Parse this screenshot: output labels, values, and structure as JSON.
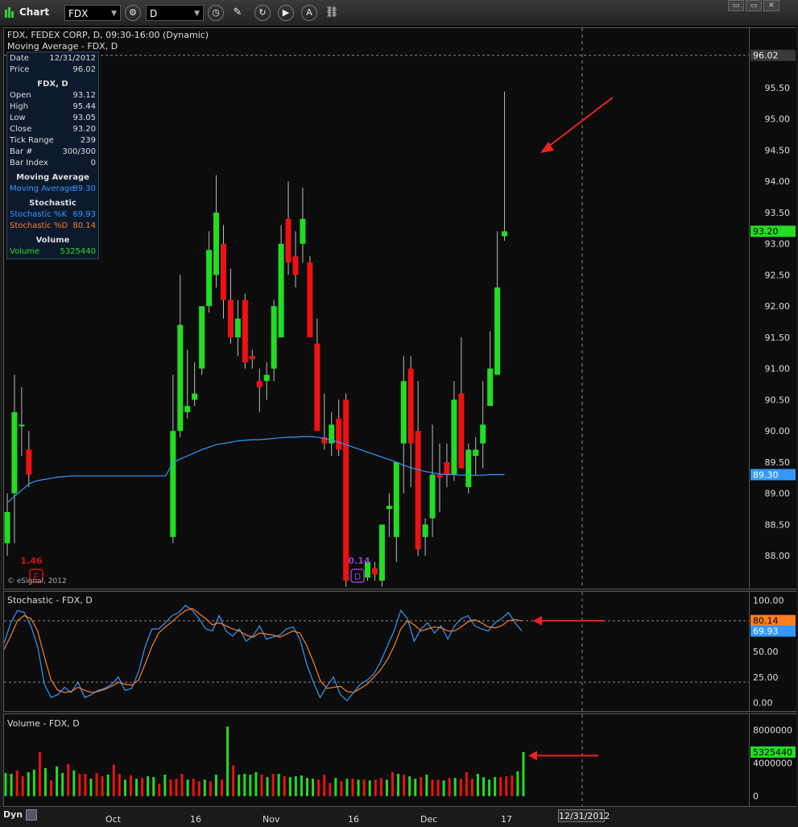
{
  "toolbar": {
    "title": "Chart",
    "symbol_value": "FDX",
    "interval_value": "D",
    "win_buttons": [
      "▭",
      "▭",
      "✕"
    ]
  },
  "price_panel": {
    "title": "FDX, FEDEX CORP, D, 09:30-16:00 (Dynamic)",
    "subtitle": "Moving Average - FDX, D",
    "copyright": "© eSignal, 2012",
    "last_price_label": "96.02",
    "close_label": "93.20",
    "ma_label": "89.30",
    "event_labels": [
      {
        "text": "1.46",
        "color": "#d01010",
        "marker": "E"
      },
      {
        "text": "0.14",
        "color": "#9040d0",
        "marker": "D"
      }
    ]
  },
  "data_window": {
    "rows1": [
      {
        "k": "Date",
        "v": "12/31/2012"
      },
      {
        "k": "Price",
        "v": "96.02"
      }
    ],
    "header_fdx": "FDX, D",
    "rows2": [
      {
        "k": "Open",
        "v": "93.12"
      },
      {
        "k": "High",
        "v": "95.44"
      },
      {
        "k": "Low",
        "v": "93.05"
      },
      {
        "k": "Close",
        "v": "93.20"
      },
      {
        "k": "Tick Range",
        "v": "239"
      },
      {
        "k": "Bar #",
        "v": "300/300"
      },
      {
        "k": "Bar Index",
        "v": "0"
      }
    ],
    "header_ma": "Moving Average",
    "ma_row": {
      "k": "Moving Average",
      "v": "89.30"
    },
    "header_stoch": "Stochastic",
    "stoch_k": {
      "k": "Stochastic %K",
      "v": "69.93"
    },
    "stoch_d": {
      "k": "Stochastic %D",
      "v": "80.14"
    },
    "header_vol": "Volume",
    "vol_row": {
      "k": "Volume",
      "v": "5325440"
    }
  },
  "stoch_panel": {
    "title": "Stochastic - FDX, D",
    "d_label": "80.14",
    "k_label": "69.93"
  },
  "volume_panel": {
    "title": "Volume - FDX, D",
    "last_label": "5325440"
  },
  "x_axis": {
    "labels": [
      "Oct",
      "16",
      "Nov",
      "16",
      "Dec",
      "17"
    ],
    "selected_date": "12/31/2012",
    "dyn_label": "Dyn"
  },
  "colors": {
    "up": "#22dd22",
    "down": "#ee1111",
    "ma": "#3399ff",
    "stoch_k": "#3399ff",
    "stoch_d": "#ff7f1e",
    "arrow": "#ee2222"
  },
  "chart_data": [
    {
      "type": "candlestick",
      "title": "FDX, FEDEX CORP, D, 09:30-16:00 (Dynamic)",
      "y_ticks": [
        88.0,
        88.5,
        89.0,
        89.5,
        90.0,
        90.5,
        91.0,
        91.5,
        92.0,
        92.5,
        93.0,
        93.5,
        94.0,
        94.5,
        95.0,
        95.5
      ],
      "y_tick_labels": [
        "88.00",
        "88.50",
        "89.00",
        "89.50",
        "90.00",
        "90.50",
        "91.00",
        "91.50",
        "92.00",
        "92.50",
        "93.00",
        "93.50",
        "94.00",
        "94.50",
        "95.00",
        "95.50"
      ],
      "ylim": [
        87.55,
        96.3
      ],
      "reference_line": 96.02,
      "candles": [
        {
          "o": 88.2,
          "h": 89.0,
          "l": 88.0,
          "c": 88.7
        },
        {
          "o": 89.0,
          "h": 90.9,
          "l": 88.2,
          "c": 90.3
        },
        {
          "o": 90.1,
          "h": 90.7,
          "l": 89.6,
          "c": 90.1
        },
        {
          "o": 89.7,
          "h": 90.0,
          "l": 89.1,
          "c": 89.3
        },
        {
          "o": null,
          "h": null,
          "l": null,
          "c": null
        },
        {
          "o": null,
          "h": null,
          "l": null,
          "c": null
        },
        {
          "o": null,
          "h": null,
          "l": null,
          "c": null
        },
        {
          "o": null,
          "h": null,
          "l": null,
          "c": null
        },
        {
          "o": null,
          "h": null,
          "l": null,
          "c": null
        },
        {
          "o": null,
          "h": null,
          "l": null,
          "c": null
        },
        {
          "o": null,
          "h": null,
          "l": null,
          "c": null
        },
        {
          "o": null,
          "h": null,
          "l": null,
          "c": null
        },
        {
          "o": null,
          "h": null,
          "l": null,
          "c": null
        },
        {
          "o": null,
          "h": null,
          "l": null,
          "c": null
        },
        {
          "o": null,
          "h": null,
          "l": null,
          "c": null
        },
        {
          "o": null,
          "h": null,
          "l": null,
          "c": null
        },
        {
          "o": null,
          "h": null,
          "l": null,
          "c": null
        },
        {
          "o": null,
          "h": null,
          "l": null,
          "c": null
        },
        {
          "o": null,
          "h": null,
          "l": null,
          "c": null
        },
        {
          "o": null,
          "h": null,
          "l": null,
          "c": null
        },
        {
          "o": null,
          "h": null,
          "l": null,
          "c": null
        },
        {
          "o": null,
          "h": null,
          "l": null,
          "c": null
        },
        {
          "o": null,
          "h": null,
          "l": null,
          "c": null
        },
        {
          "o": 88.3,
          "h": 90.9,
          "l": 88.2,
          "c": 90.0
        },
        {
          "o": 90.0,
          "h": 92.5,
          "l": 89.9,
          "c": 91.7
        },
        {
          "o": 90.3,
          "h": 91.3,
          "l": 90.2,
          "c": 90.4
        },
        {
          "o": 90.5,
          "h": 91.1,
          "l": 90.4,
          "c": 90.6
        },
        {
          "o": 91.0,
          "h": 92.0,
          "l": 90.9,
          "c": 92.0
        },
        {
          "o": 92.0,
          "h": 93.2,
          "l": 91.9,
          "c": 92.9
        },
        {
          "o": 92.5,
          "h": 94.1,
          "l": 92.3,
          "c": 93.5
        },
        {
          "o": 93.0,
          "h": 93.3,
          "l": 91.8,
          "c": 92.1
        },
        {
          "o": 92.1,
          "h": 92.6,
          "l": 91.4,
          "c": 91.5
        },
        {
          "o": 91.5,
          "h": 92.1,
          "l": 91.2,
          "c": 91.8
        },
        {
          "o": 92.1,
          "h": 92.2,
          "l": 91.0,
          "c": 91.1
        },
        {
          "o": 91.2,
          "h": 91.3,
          "l": 91.0,
          "c": 91.15
        },
        {
          "o": 90.8,
          "h": 91.0,
          "l": 90.3,
          "c": 90.7
        },
        {
          "o": 90.8,
          "h": 91.1,
          "l": 90.5,
          "c": 90.9
        },
        {
          "o": 91.0,
          "h": 92.1,
          "l": 90.8,
          "c": 92.0
        },
        {
          "o": 91.5,
          "h": 93.3,
          "l": 91.5,
          "c": 93.0
        },
        {
          "o": 93.4,
          "h": 94.0,
          "l": 92.5,
          "c": 92.7
        },
        {
          "o": 92.8,
          "h": 93.2,
          "l": 92.3,
          "c": 92.5
        },
        {
          "o": 93.0,
          "h": 93.9,
          "l": 92.7,
          "c": 93.4
        },
        {
          "o": 92.7,
          "h": 92.8,
          "l": 91.5,
          "c": 91.5
        },
        {
          "o": 91.4,
          "h": 91.8,
          "l": 90.0,
          "c": 90.0
        },
        {
          "o": 89.9,
          "h": 90.6,
          "l": 89.7,
          "c": 89.8
        },
        {
          "o": 89.8,
          "h": 90.3,
          "l": 89.6,
          "c": 90.1
        },
        {
          "o": 90.2,
          "h": 90.5,
          "l": 89.6,
          "c": 89.7
        },
        {
          "o": 90.5,
          "h": 90.6,
          "l": 87.5,
          "c": 87.6
        },
        {
          "o": null,
          "h": null,
          "l": null,
          "c": null
        },
        {
          "o": null,
          "h": null,
          "l": null,
          "c": null
        },
        {
          "o": 87.65,
          "h": 87.9,
          "l": 87.6,
          "c": 87.9
        },
        {
          "o": 87.8,
          "h": 87.9,
          "l": 87.6,
          "c": 87.7
        },
        {
          "o": 87.6,
          "h": 88.5,
          "l": 87.5,
          "c": 88.5
        },
        {
          "o": 88.75,
          "h": 89.0,
          "l": 88.3,
          "c": 88.8
        },
        {
          "o": 88.3,
          "h": 89.5,
          "l": 87.9,
          "c": 89.5
        },
        {
          "o": 89.8,
          "h": 91.2,
          "l": 89.0,
          "c": 90.8
        },
        {
          "o": 91.0,
          "h": 91.2,
          "l": 89.1,
          "c": 89.8
        },
        {
          "o": 90.0,
          "h": 90.8,
          "l": 88.0,
          "c": 88.1
        },
        {
          "o": 88.3,
          "h": 88.6,
          "l": 88.0,
          "c": 88.5
        },
        {
          "o": 88.6,
          "h": 90.1,
          "l": 88.3,
          "c": 89.3
        },
        {
          "o": 89.3,
          "h": 89.8,
          "l": 88.7,
          "c": 89.25
        },
        {
          "o": 89.5,
          "h": 89.8,
          "l": 89.1,
          "c": 89.3
        },
        {
          "o": 89.3,
          "h": 90.8,
          "l": 89.2,
          "c": 90.5
        },
        {
          "o": 90.6,
          "h": 91.5,
          "l": 89.5,
          "c": 89.4
        },
        {
          "o": 89.1,
          "h": 89.8,
          "l": 89.0,
          "c": 89.7
        },
        {
          "o": 89.6,
          "h": 89.9,
          "l": 89.3,
          "c": 89.7
        },
        {
          "o": 89.8,
          "h": 90.8,
          "l": 89.4,
          "c": 90.1
        },
        {
          "o": 90.4,
          "h": 91.6,
          "l": 90.4,
          "c": 91.0
        },
        {
          "o": 90.9,
          "h": 93.2,
          "l": 90.9,
          "c": 92.3
        },
        {
          "o": 93.12,
          "h": 95.44,
          "l": 93.05,
          "c": 93.2
        }
      ],
      "moving_average": [
        88.85,
        88.95,
        89.05,
        89.15,
        89.2,
        89.22,
        89.24,
        89.26,
        89.27,
        89.28,
        89.28,
        89.28,
        89.28,
        89.28,
        89.28,
        89.28,
        89.28,
        89.28,
        89.28,
        89.28,
        89.28,
        89.28,
        89.28,
        89.5,
        89.55,
        89.6,
        89.65,
        89.7,
        89.74,
        89.78,
        89.8,
        89.82,
        89.84,
        89.85,
        89.86,
        89.86,
        89.87,
        89.88,
        89.89,
        89.9,
        89.9,
        89.91,
        89.91,
        89.9,
        89.88,
        89.85,
        89.82,
        89.78,
        89.74,
        89.7,
        89.66,
        89.62,
        89.58,
        89.54,
        89.5,
        89.45,
        89.41,
        89.38,
        89.35,
        89.33,
        89.31,
        89.3,
        89.3,
        89.29,
        89.29,
        89.29,
        89.29,
        89.3,
        89.3,
        89.3
      ]
    },
    {
      "type": "line",
      "title": "Stochastic - FDX, D",
      "y_ticks": [
        0,
        25,
        50,
        75,
        100
      ],
      "y_tick_labels": [
        "0.00",
        "25.00",
        "50.00",
        "75.00",
        "100.00"
      ],
      "ylim": [
        -5,
        105
      ],
      "reference_lines": [
        20,
        80
      ],
      "series": [
        {
          "name": "Stochastic %K",
          "values": [
            58,
            78,
            90,
            88,
            75,
            55,
            18,
            5,
            8,
            15,
            10,
            20,
            5,
            8,
            12,
            14,
            18,
            25,
            12,
            14,
            30,
            55,
            72,
            72,
            78,
            85,
            88,
            95,
            90,
            82,
            72,
            70,
            85,
            70,
            65,
            72,
            60,
            65,
            75,
            62,
            64,
            66,
            72,
            74,
            62,
            38,
            20,
            5,
            16,
            25,
            8,
            2,
            10,
            18,
            22,
            28,
            40,
            55,
            70,
            90,
            82,
            60,
            72,
            78,
            68,
            75,
            62,
            75,
            82,
            85,
            75,
            72,
            70,
            78,
            82,
            88,
            78,
            70
          ]
        },
        {
          "name": "Stochastic %D",
          "values": [
            52,
            65,
            80,
            85,
            82,
            70,
            45,
            22,
            12,
            10,
            11,
            15,
            12,
            10,
            11,
            13,
            16,
            20,
            18,
            17,
            22,
            38,
            55,
            68,
            74,
            79,
            85,
            90,
            92,
            87,
            82,
            76,
            78,
            75,
            72,
            70,
            66,
            64,
            68,
            67,
            66,
            64,
            67,
            70,
            68,
            56,
            40,
            22,
            14,
            15,
            16,
            11,
            10,
            14,
            18,
            25,
            32,
            42,
            55,
            72,
            80,
            76,
            70,
            72,
            74,
            73,
            70,
            70,
            74,
            79,
            81,
            78,
            74,
            73,
            75,
            80,
            81,
            80
          ]
        }
      ]
    },
    {
      "type": "bar",
      "title": "Volume - FDX, D",
      "y_ticks": [
        0,
        4000000,
        8000000
      ],
      "y_tick_labels": [
        "0",
        "4000000",
        "8000000"
      ],
      "ylim": [
        -1000000,
        9500000
      ],
      "values": [
        2800000,
        2700000,
        3100000,
        2400000,
        2900000,
        3200000,
        5300000,
        3400000,
        1900000,
        3600000,
        2800000,
        3900000,
        3100000,
        2700000,
        2700000,
        2100000,
        2800000,
        2400000,
        2600000,
        3800000,
        2700000,
        2000000,
        2500000,
        2100000,
        2200000,
        2400000,
        2300000,
        1500000,
        2600000,
        2000000,
        2100000,
        2700000,
        2000000,
        2100000,
        1800000,
        2000000,
        1800000,
        2600000,
        2000000,
        8400000,
        3700000,
        2600000,
        2700000,
        2600000,
        2900000,
        2600000,
        2300000,
        2700000,
        2700000,
        2400000,
        2300000,
        2400000,
        2500000,
        2200000,
        2100000,
        2000000,
        2600000,
        1600000,
        2200000,
        1800000,
        2100000,
        2100000,
        2000000,
        2000000,
        1900000,
        2000000,
        2200000,
        2000000,
        2900000,
        2700000,
        2600000,
        2400000,
        2100000,
        2300000,
        2600000,
        2000000,
        2000000,
        1900000,
        2200000,
        2200000,
        2100000,
        2900000,
        2100000,
        2700000,
        2300000,
        2000000,
        2300000,
        2300000,
        2400000,
        2500000,
        3000000,
        5325440
      ],
      "up": [
        true,
        true,
        false,
        false,
        true,
        true,
        false,
        true,
        false,
        true,
        true,
        false,
        true,
        false,
        false,
        true,
        false,
        false,
        true,
        false,
        false,
        true,
        false,
        true,
        false,
        true,
        true,
        false,
        true,
        false,
        false,
        false,
        true,
        false,
        false,
        true,
        false,
        true,
        false,
        true,
        false,
        true,
        true,
        true,
        true,
        false,
        true,
        false,
        true,
        false,
        true,
        true,
        true,
        true,
        true,
        false,
        false,
        false,
        true,
        false,
        true,
        false,
        true,
        false,
        true,
        false,
        false,
        true,
        false,
        true,
        false,
        true,
        true,
        false,
        true,
        false,
        false,
        true,
        false,
        true,
        false,
        false,
        false,
        true,
        true,
        true,
        true,
        false,
        false,
        false,
        true,
        true
      ]
    }
  ]
}
